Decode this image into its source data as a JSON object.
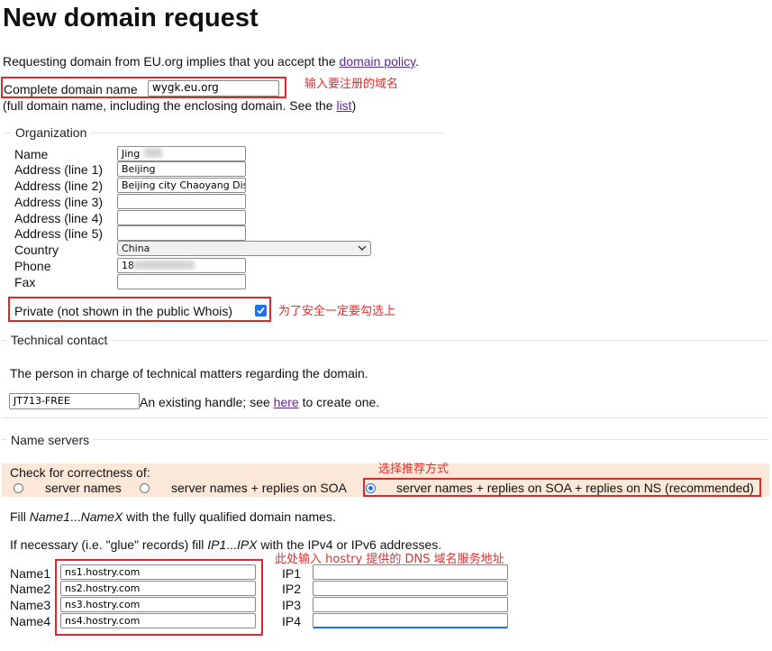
{
  "page": {
    "title": "New domain request",
    "intro_before": "Requesting domain from EU.org implies that you accept the ",
    "intro_link": "domain policy",
    "intro_after": "."
  },
  "domain": {
    "label": "Complete domain name",
    "value": "wygk.eu.org",
    "help_before": "(full domain name, including the enclosing domain. See the ",
    "help_link": "list",
    "help_after": ")"
  },
  "organization": {
    "legend": "Organization",
    "fields": [
      {
        "label": "Name",
        "value": "Jing"
      },
      {
        "label": "Address (line 1)",
        "value": "Beijing"
      },
      {
        "label": "Address (line 2)",
        "value": "Beijing city Chaoyang Dist"
      },
      {
        "label": "Address (line 3)",
        "value": ""
      },
      {
        "label": "Address (line 4)",
        "value": ""
      },
      {
        "label": "Address (line 5)",
        "value": ""
      }
    ],
    "country_label": "Country",
    "country_value": "China",
    "phone_label": "Phone",
    "phone_value": "18",
    "fax_label": "Fax",
    "fax_value": "",
    "private_label": "Private (not shown in the public Whois)",
    "private_checked": true
  },
  "technical": {
    "legend": "Technical contact",
    "description": "The person in charge of technical matters regarding the domain.",
    "handle_value": "JT713-FREE",
    "handle_text_before": "An existing handle; see ",
    "handle_link": "here",
    "handle_text_after": " to create one."
  },
  "nameservers": {
    "legend": "Name servers",
    "check_label": "Check for correctness of:",
    "options": [
      "server names",
      "server names + replies on SOA",
      "server names + replies on SOA + replies on NS (recommended)"
    ],
    "selected_option": 2,
    "fill_line_parts": [
      "Fill ",
      "Name1",
      "...",
      "NameX",
      " with the fully qualified domain names."
    ],
    "glue_line_parts": [
      "If necessary (i.e. \"glue\" records) fill ",
      "IP1",
      "...",
      "IPX",
      " with the IPv4 or IPv6 addresses."
    ],
    "names": [
      {
        "label": "Name1",
        "value": "ns1.hostry.com",
        "ip_label": "IP1",
        "ip_value": ""
      },
      {
        "label": "Name2",
        "value": "ns2.hostry.com",
        "ip_label": "IP2",
        "ip_value": ""
      },
      {
        "label": "Name3",
        "value": "ns3.hostry.com",
        "ip_label": "IP3",
        "ip_value": ""
      },
      {
        "label": "Name4",
        "value": "ns4.hostry.com",
        "ip_label": "IP4",
        "ip_value": ""
      }
    ]
  },
  "annotations": {
    "domain_note": "输入要注册的域名",
    "private_note": "为了安全一定要勾选上",
    "recommend_note": "选择推荐方式",
    "dns_note": "此处输入 hostry 提供的 DNS 域名服务地址"
  },
  "colors": {
    "link": "#5b2a93",
    "annotation_red": "#e02828",
    "check_bg": "#fbe8d8",
    "accent": "#1a73e8"
  },
  "icons": [
    "checkbox-checked-icon",
    "chevron-down-icon",
    "radio-selected-icon"
  ]
}
